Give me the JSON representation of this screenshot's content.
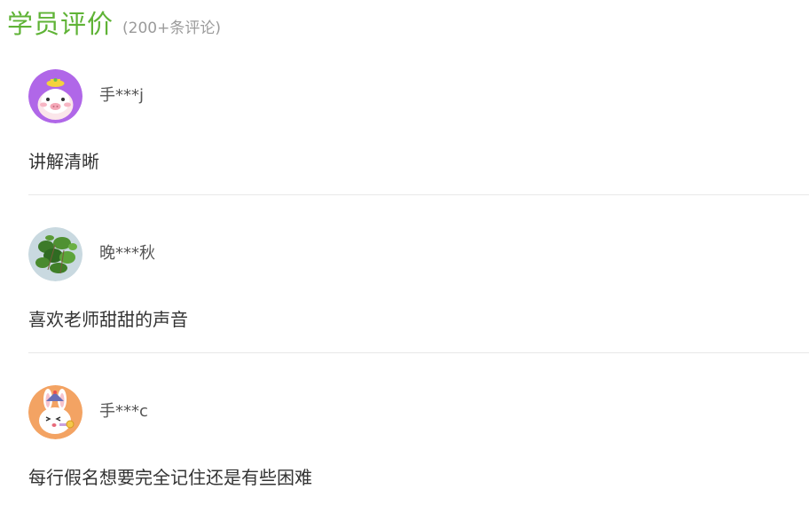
{
  "header": {
    "title": "学员评价",
    "count": "(200+条评论)"
  },
  "reviews": [
    {
      "username": "手***j",
      "comment": "讲解清晰",
      "avatar_icon": "pig-cartoon-avatar"
    },
    {
      "username": "晚***秋",
      "comment": "喜欢老师甜甜的声音",
      "avatar_icon": "green-plant-avatar"
    },
    {
      "username": "手***c",
      "comment": "每行假名想要完全记住还是有些困难",
      "avatar_icon": "rabbit-cartoon-avatar"
    }
  ],
  "colors": {
    "title_green": "#5fb336",
    "count_gray": "#9b9b9b",
    "username_gray": "#555555",
    "comment_text": "#333333",
    "divider": "#e8e8e8"
  }
}
